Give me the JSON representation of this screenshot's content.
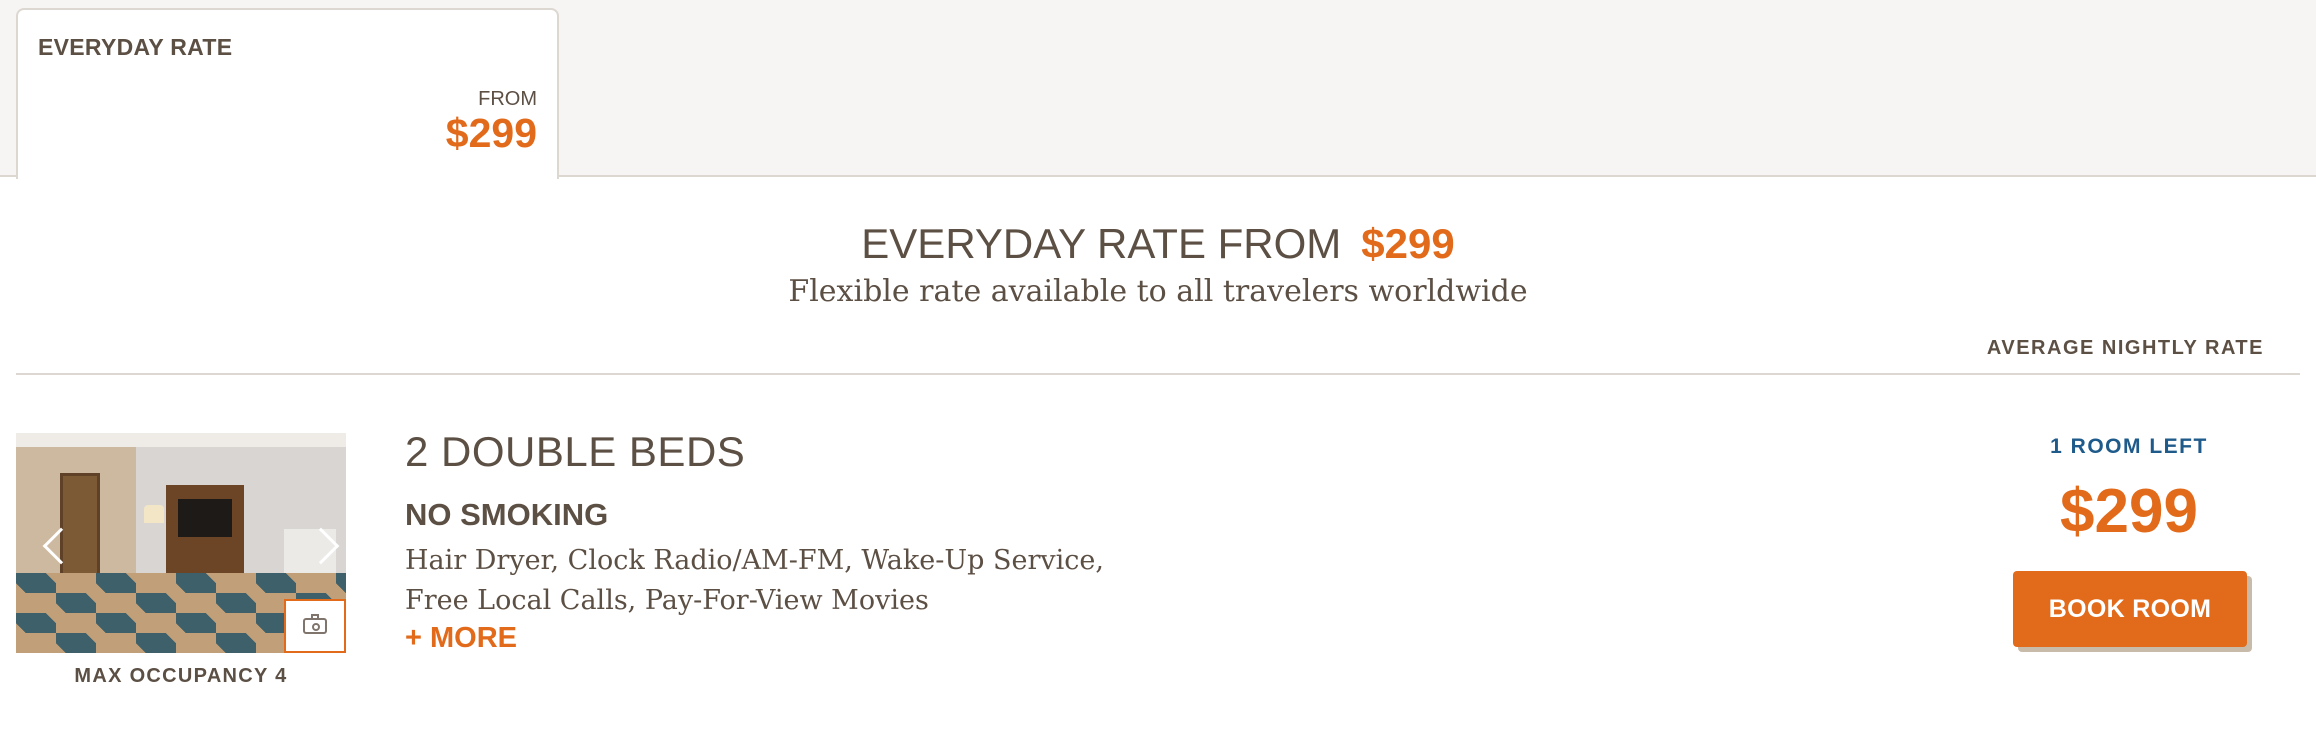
{
  "rate_tab": {
    "name": "EVERYDAY RATE",
    "from_label": "FROM",
    "price": "$299"
  },
  "rate_header": {
    "title": "EVERYDAY RATE FROM",
    "price": "$299",
    "description": "Flexible rate available to all travelers worldwide",
    "column_label": "AVERAGE NIGHTLY RATE"
  },
  "room": {
    "name": "2 DOUBLE BEDS",
    "smoking_policy": "NO SMOKING",
    "amenities_line1": "Hair Dryer, Clock Radio/AM-FM, Wake-Up Service,",
    "amenities_line2": "Free Local Calls, Pay-For-View Movies",
    "more_label": "+ MORE",
    "max_occupancy": "MAX OCCUPANCY 4",
    "rooms_left": "1 ROOM LEFT",
    "price": "$299",
    "book_label": "BOOK ROOM"
  },
  "photo": {
    "icons": [
      "chevron-left-icon",
      "chevron-right-icon",
      "camera-icon"
    ]
  },
  "colors": {
    "accent": "#e26a1b",
    "text": "#5c4f44",
    "availability": "#1e5a8a"
  }
}
